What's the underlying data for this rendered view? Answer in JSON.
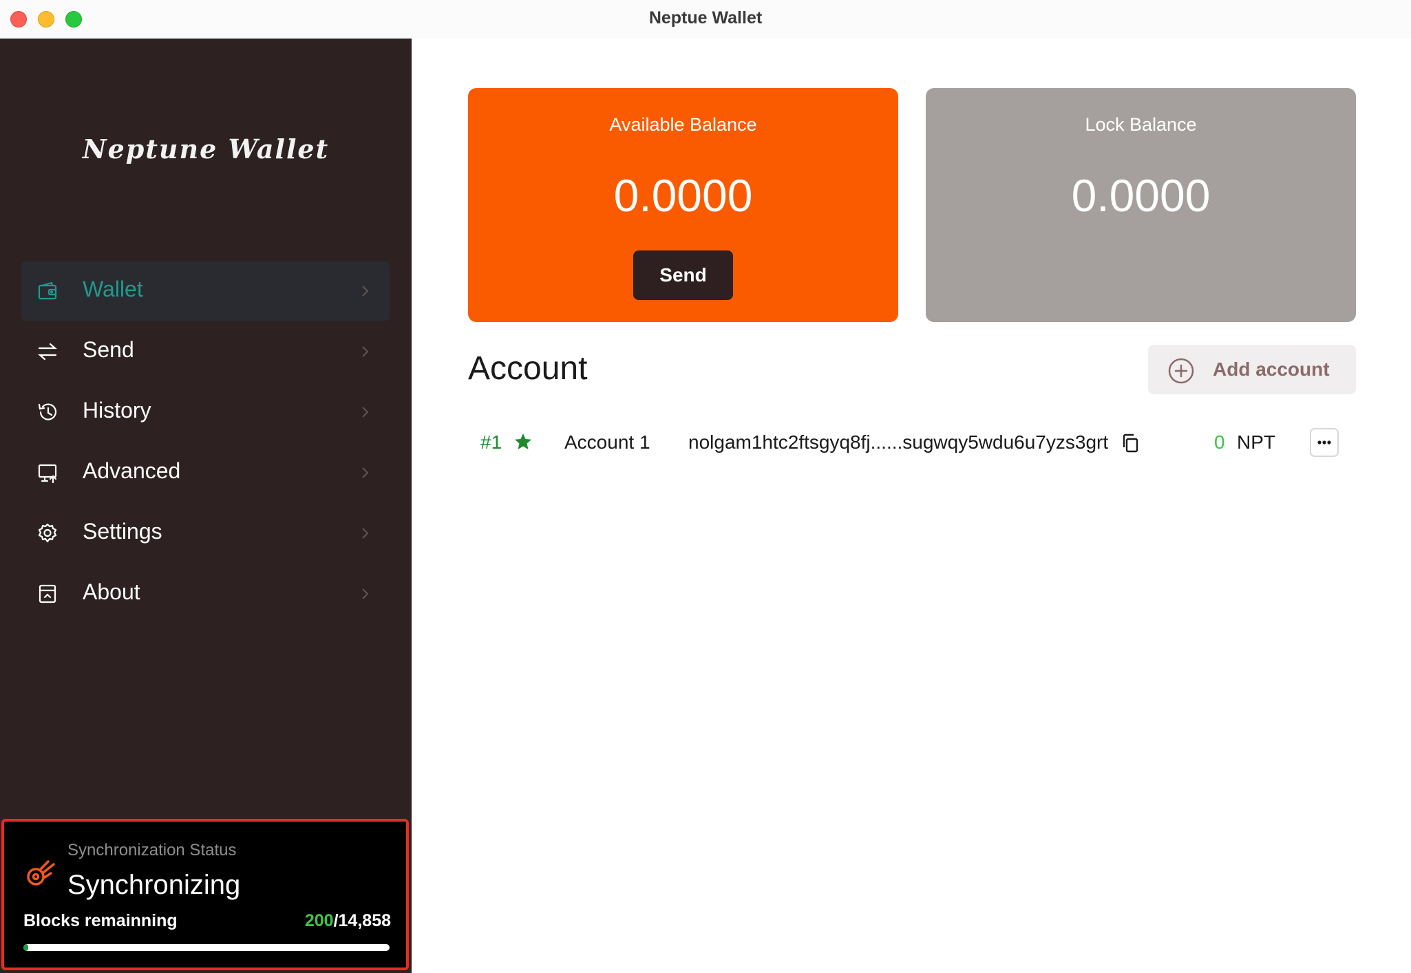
{
  "window": {
    "title": "Neptue Wallet"
  },
  "sidebar": {
    "logo": "Neptune Wallet",
    "items": [
      {
        "label": "Wallet",
        "icon": "wallet-icon",
        "active": true
      },
      {
        "label": "Send",
        "icon": "transfer-arrows-icon",
        "active": false
      },
      {
        "label": "History",
        "icon": "history-clock-icon",
        "active": false
      },
      {
        "label": "Advanced",
        "icon": "monitor-upload-icon",
        "active": false
      },
      {
        "label": "Settings",
        "icon": "gear-icon",
        "active": false
      },
      {
        "label": "About",
        "icon": "info-window-icon",
        "active": false
      }
    ]
  },
  "sync": {
    "subtitle": "Synchronization Status",
    "status": "Synchronizing",
    "blocks_label": "Blocks remainning",
    "blocks_done": "200",
    "separator": "/",
    "blocks_total": "14,858",
    "progress": 0.013
  },
  "balances": {
    "available": {
      "label": "Available Balance",
      "value": "0.0000",
      "button": "Send"
    },
    "lock": {
      "label": "Lock Balance",
      "value": "0.0000"
    }
  },
  "accounts": {
    "heading": "Account",
    "add_label": "Add account",
    "rows": [
      {
        "index": "#1",
        "name": "Account 1",
        "address": "nolgam1htc2ftsgyq8fj......sugwqy5wdu6u7yzs3grt",
        "amount": "0",
        "unit": "NPT"
      }
    ]
  },
  "colors": {
    "accent_orange": "#fa5b01",
    "sidebar_bg": "#2d2122",
    "active_teal": "#1e9b8e",
    "success_green": "#3ec44a"
  }
}
